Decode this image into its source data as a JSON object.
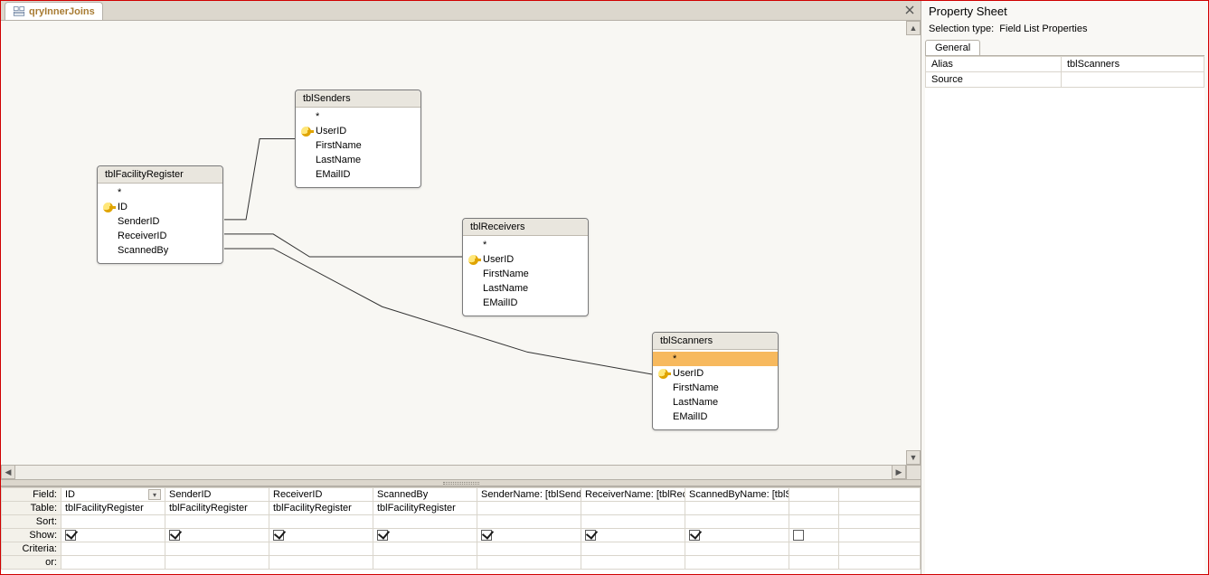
{
  "tab": {
    "title": "qryInnerJoins"
  },
  "tables": {
    "facility": {
      "title": "tblFacilityRegister",
      "fields": [
        "*",
        "ID",
        "SenderID",
        "ReceiverID",
        "ScannedBy"
      ],
      "pkIndex": 1
    },
    "senders": {
      "title": "tblSenders",
      "fields": [
        "*",
        "UserID",
        "FirstName",
        "LastName",
        "EMailID"
      ],
      "pkIndex": 1
    },
    "receivers": {
      "title": "tblReceivers",
      "fields": [
        "*",
        "UserID",
        "FirstName",
        "LastName",
        "EMailID"
      ],
      "pkIndex": 1
    },
    "scanners": {
      "title": "tblScanners",
      "fields": [
        "*",
        "UserID",
        "FirstName",
        "LastName",
        "EMailID"
      ],
      "pkIndex": 1,
      "selectedIndex": 0
    }
  },
  "qbe": {
    "rowLabels": {
      "field": "Field:",
      "table": "Table:",
      "sort": "Sort:",
      "show": "Show:",
      "criteria": "Criteria:",
      "or": "or:"
    },
    "columns": [
      {
        "field": "ID",
        "table": "tblFacilityRegister",
        "show": true,
        "dropdown": true
      },
      {
        "field": "SenderID",
        "table": "tblFacilityRegister",
        "show": true
      },
      {
        "field": "ReceiverID",
        "table": "tblFacilityRegister",
        "show": true
      },
      {
        "field": "ScannedBy",
        "table": "tblFacilityRegister",
        "show": true
      },
      {
        "field": "SenderName: [tblSenders]![FirstName]",
        "table": "",
        "show": true
      },
      {
        "field": "ReceiverName: [tblReceivers]![FirstName]",
        "table": "",
        "show": true
      },
      {
        "field": "ScannedByName: [tblScanners]![FirstName]",
        "table": "",
        "show": true
      },
      {
        "field": "",
        "table": "",
        "show": false
      }
    ]
  },
  "propertySheet": {
    "title": "Property Sheet",
    "selectionLabel": "Selection type:",
    "selectionType": "Field List Properties",
    "tab": "General",
    "rows": [
      {
        "name": "Alias",
        "value": "tblScanners"
      },
      {
        "name": "Source",
        "value": ""
      }
    ]
  }
}
